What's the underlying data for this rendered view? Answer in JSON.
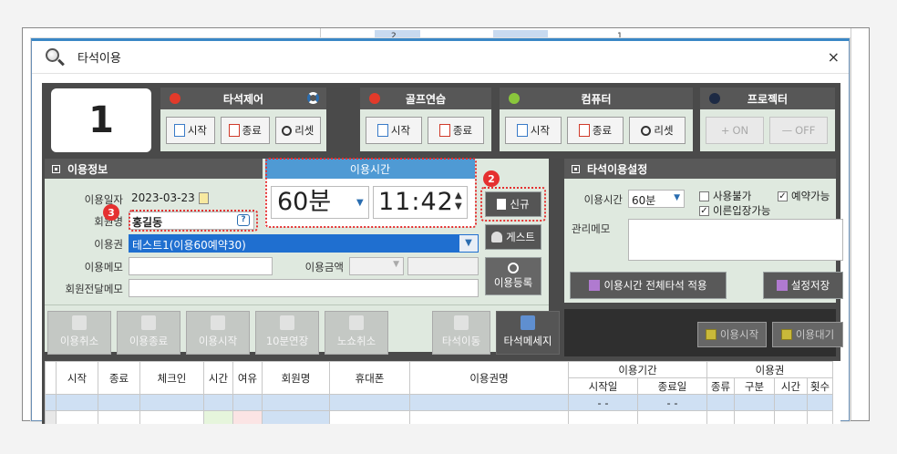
{
  "background": {
    "cells": [
      "2",
      "1"
    ]
  },
  "dialog": {
    "title": "타석이용",
    "close_label": "×"
  },
  "seat_number": "1",
  "control_groups": [
    {
      "title": "타석제어",
      "led_color": "#e23a2a",
      "buttons": [
        "시작",
        "종료",
        "리셋"
      ]
    },
    {
      "title": "골프연습",
      "led_color": "#e23a2a",
      "buttons": [
        "시작",
        "종료"
      ]
    },
    {
      "title": "컴퓨터",
      "led_color": "#8ac63c",
      "buttons": [
        "시작",
        "종료",
        "리셋"
      ]
    },
    {
      "title": "프로젝터",
      "led_color": "#1d2a44",
      "buttons": [
        "ON",
        "OFF"
      ]
    }
  ],
  "usage_info": {
    "header": "이용정보",
    "use_date_label": "이용일자",
    "use_date": "2023-03-23",
    "member_name_label": "회원명",
    "member_name": "홍길동",
    "ticket_label": "이용권",
    "ticket_value": "테스트1(이용60예약30)",
    "memo_label": "이용메모",
    "amount_label": "이용금액",
    "member_memo_label": "회원전달메모"
  },
  "usage_time": {
    "header": "이용시간",
    "minutes": "60분",
    "clock": "11:42"
  },
  "side_buttons": {
    "new": "신규",
    "guest": "게스트",
    "register": "이용등록"
  },
  "badges": [
    "2",
    "3"
  ],
  "action_buttons": [
    {
      "label": "이용취소",
      "active": false
    },
    {
      "label": "이용종료",
      "active": false
    },
    {
      "label": "이용시작",
      "active": false
    },
    {
      "label": "10분연장",
      "active": false
    },
    {
      "label": "노쇼취소",
      "active": false
    },
    {
      "label": "타석이동",
      "active": false
    },
    {
      "label": "타석메세지",
      "active": true
    }
  ],
  "seat_settings": {
    "header": "타석이용설정",
    "time_label": "이용시간",
    "time_value": "60분",
    "unavailable": "사용불가",
    "reservable": "예약가능",
    "early_entry": "이른입장가능",
    "memo_label": "관리메모",
    "apply_all_button": "이용시간 전체타석 적용",
    "save_button": "설정저장"
  },
  "dark_buttons": {
    "start": "이용시작",
    "wait": "이용대기"
  },
  "grid": {
    "columns": [
      "시작",
      "종료",
      "체크인",
      "시간",
      "여유",
      "회원명",
      "휴대폰",
      "이용권명"
    ],
    "period_header": "이용기간",
    "period_sub": [
      "시작일",
      "종료일"
    ],
    "ticket_header": "이용권",
    "ticket_sub": [
      "종류",
      "구분",
      "시간",
      "횟수"
    ],
    "period_values": [
      "-  -",
      "-  -"
    ]
  }
}
